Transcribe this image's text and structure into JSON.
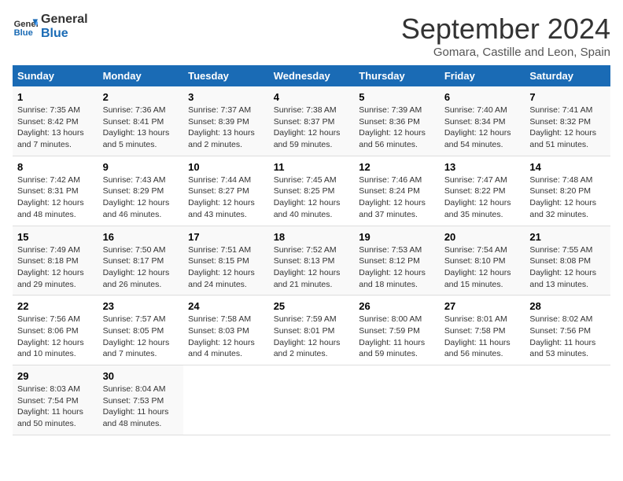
{
  "logo": {
    "line1": "General",
    "line2": "Blue"
  },
  "title": "September 2024",
  "subtitle": "Gomara, Castille and Leon, Spain",
  "days_header": [
    "Sunday",
    "Monday",
    "Tuesday",
    "Wednesday",
    "Thursday",
    "Friday",
    "Saturday"
  ],
  "weeks": [
    [
      {
        "day": "1",
        "info": "Sunrise: 7:35 AM\nSunset: 8:42 PM\nDaylight: 13 hours and 7 minutes."
      },
      {
        "day": "2",
        "info": "Sunrise: 7:36 AM\nSunset: 8:41 PM\nDaylight: 13 hours and 5 minutes."
      },
      {
        "day": "3",
        "info": "Sunrise: 7:37 AM\nSunset: 8:39 PM\nDaylight: 13 hours and 2 minutes."
      },
      {
        "day": "4",
        "info": "Sunrise: 7:38 AM\nSunset: 8:37 PM\nDaylight: 12 hours and 59 minutes."
      },
      {
        "day": "5",
        "info": "Sunrise: 7:39 AM\nSunset: 8:36 PM\nDaylight: 12 hours and 56 minutes."
      },
      {
        "day": "6",
        "info": "Sunrise: 7:40 AM\nSunset: 8:34 PM\nDaylight: 12 hours and 54 minutes."
      },
      {
        "day": "7",
        "info": "Sunrise: 7:41 AM\nSunset: 8:32 PM\nDaylight: 12 hours and 51 minutes."
      }
    ],
    [
      {
        "day": "8",
        "info": "Sunrise: 7:42 AM\nSunset: 8:31 PM\nDaylight: 12 hours and 48 minutes."
      },
      {
        "day": "9",
        "info": "Sunrise: 7:43 AM\nSunset: 8:29 PM\nDaylight: 12 hours and 46 minutes."
      },
      {
        "day": "10",
        "info": "Sunrise: 7:44 AM\nSunset: 8:27 PM\nDaylight: 12 hours and 43 minutes."
      },
      {
        "day": "11",
        "info": "Sunrise: 7:45 AM\nSunset: 8:25 PM\nDaylight: 12 hours and 40 minutes."
      },
      {
        "day": "12",
        "info": "Sunrise: 7:46 AM\nSunset: 8:24 PM\nDaylight: 12 hours and 37 minutes."
      },
      {
        "day": "13",
        "info": "Sunrise: 7:47 AM\nSunset: 8:22 PM\nDaylight: 12 hours and 35 minutes."
      },
      {
        "day": "14",
        "info": "Sunrise: 7:48 AM\nSunset: 8:20 PM\nDaylight: 12 hours and 32 minutes."
      }
    ],
    [
      {
        "day": "15",
        "info": "Sunrise: 7:49 AM\nSunset: 8:18 PM\nDaylight: 12 hours and 29 minutes."
      },
      {
        "day": "16",
        "info": "Sunrise: 7:50 AM\nSunset: 8:17 PM\nDaylight: 12 hours and 26 minutes."
      },
      {
        "day": "17",
        "info": "Sunrise: 7:51 AM\nSunset: 8:15 PM\nDaylight: 12 hours and 24 minutes."
      },
      {
        "day": "18",
        "info": "Sunrise: 7:52 AM\nSunset: 8:13 PM\nDaylight: 12 hours and 21 minutes."
      },
      {
        "day": "19",
        "info": "Sunrise: 7:53 AM\nSunset: 8:12 PM\nDaylight: 12 hours and 18 minutes."
      },
      {
        "day": "20",
        "info": "Sunrise: 7:54 AM\nSunset: 8:10 PM\nDaylight: 12 hours and 15 minutes."
      },
      {
        "day": "21",
        "info": "Sunrise: 7:55 AM\nSunset: 8:08 PM\nDaylight: 12 hours and 13 minutes."
      }
    ],
    [
      {
        "day": "22",
        "info": "Sunrise: 7:56 AM\nSunset: 8:06 PM\nDaylight: 12 hours and 10 minutes."
      },
      {
        "day": "23",
        "info": "Sunrise: 7:57 AM\nSunset: 8:05 PM\nDaylight: 12 hours and 7 minutes."
      },
      {
        "day": "24",
        "info": "Sunrise: 7:58 AM\nSunset: 8:03 PM\nDaylight: 12 hours and 4 minutes."
      },
      {
        "day": "25",
        "info": "Sunrise: 7:59 AM\nSunset: 8:01 PM\nDaylight: 12 hours and 2 minutes."
      },
      {
        "day": "26",
        "info": "Sunrise: 8:00 AM\nSunset: 7:59 PM\nDaylight: 11 hours and 59 minutes."
      },
      {
        "day": "27",
        "info": "Sunrise: 8:01 AM\nSunset: 7:58 PM\nDaylight: 11 hours and 56 minutes."
      },
      {
        "day": "28",
        "info": "Sunrise: 8:02 AM\nSunset: 7:56 PM\nDaylight: 11 hours and 53 minutes."
      }
    ],
    [
      {
        "day": "29",
        "info": "Sunrise: 8:03 AM\nSunset: 7:54 PM\nDaylight: 11 hours and 50 minutes."
      },
      {
        "day": "30",
        "info": "Sunrise: 8:04 AM\nSunset: 7:53 PM\nDaylight: 11 hours and 48 minutes."
      },
      null,
      null,
      null,
      null,
      null
    ]
  ]
}
